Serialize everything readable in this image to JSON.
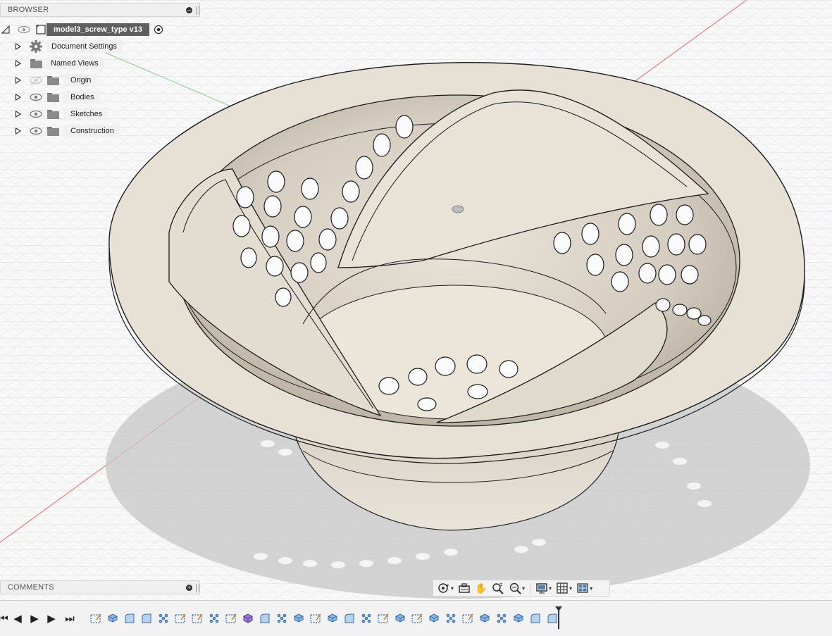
{
  "browser": {
    "header": "BROWSER",
    "root": {
      "label": "model3_screw_type v13"
    },
    "items": [
      {
        "label": "Document Settings",
        "icon": "gear-icon",
        "has_eye": false
      },
      {
        "label": "Named Views",
        "icon": "folder-icon",
        "has_eye": false
      },
      {
        "label": "Origin",
        "icon": "folder-icon",
        "has_eye": true,
        "eye_hidden": true
      },
      {
        "label": "Bodies",
        "icon": "folder-icon",
        "has_eye": true,
        "eye_hidden": false
      },
      {
        "label": "Sketches",
        "icon": "folder-icon",
        "has_eye": true,
        "eye_hidden": false
      },
      {
        "label": "Construction",
        "icon": "folder-icon",
        "has_eye": true,
        "eye_hidden": false
      }
    ]
  },
  "comments": {
    "header": "COMMENTS"
  },
  "navbar": {
    "buttons": [
      "orbit-icon",
      "look-at-icon",
      "pan-icon",
      "zoom-icon",
      "fit-icon",
      "display-settings-icon",
      "grid-settings-icon",
      "viewports-icon"
    ]
  },
  "timeline": {
    "controls": [
      "go-to-start-icon",
      "step-back-icon",
      "play-icon",
      "step-forward-icon",
      "go-to-end-icon"
    ],
    "features": [
      "sketch",
      "extrude",
      "fillet",
      "fillet",
      "pattern",
      "sketch",
      "sketch",
      "pattern",
      "sketch",
      "box",
      "fillet",
      "pattern",
      "extrude",
      "sketch",
      "extrude",
      "fillet",
      "pattern",
      "sketch",
      "extrude",
      "sketch",
      "extrude",
      "pattern",
      "sketch",
      "extrude",
      "pattern",
      "extrude",
      "fillet",
      "fillet"
    ]
  },
  "colors": {
    "model_fill": "#ece6dc",
    "model_shadow": "#cdc5b8",
    "edge": "#222222",
    "x_axis": "#e06060",
    "y_axis": "#79c879",
    "grid": "#cfd5dc"
  }
}
